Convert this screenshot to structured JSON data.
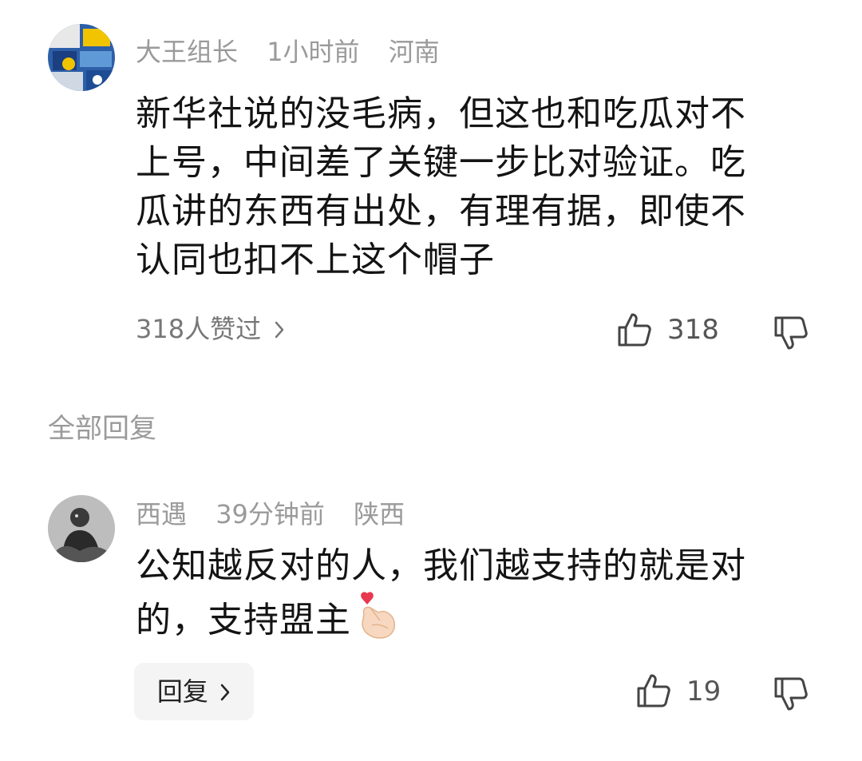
{
  "comment": {
    "username": "大王组长",
    "time": "1小时前",
    "location": "河南",
    "body_lines": [
      "新华社说的没毛病，但这也和吃瓜对不",
      "上号，中间差了关键一步比对验证。吃",
      "瓜讲的东西有出处，有理有据，即使不",
      "认同也扣不上这个帽子"
    ],
    "likes_summary": "318人赞过",
    "like_count": "318",
    "avatar_icon": "avatar-blue-collage"
  },
  "replies_section": {
    "title": "全部回复"
  },
  "reply": {
    "username": "西遇",
    "time": "39分钟前",
    "location": "陕西",
    "body_lines": [
      "公知越反对的人，我们越支持的就是对",
      "的，支持盟主"
    ],
    "emoji_icon": "finger-heart-emoji",
    "reply_label": "回复",
    "like_count": "19",
    "avatar_icon": "avatar-bw-photo"
  },
  "colors": {
    "text": "#141414",
    "meta": "#9a9a9a",
    "icon": "#444444",
    "button_bg": "#f4f4f4"
  }
}
